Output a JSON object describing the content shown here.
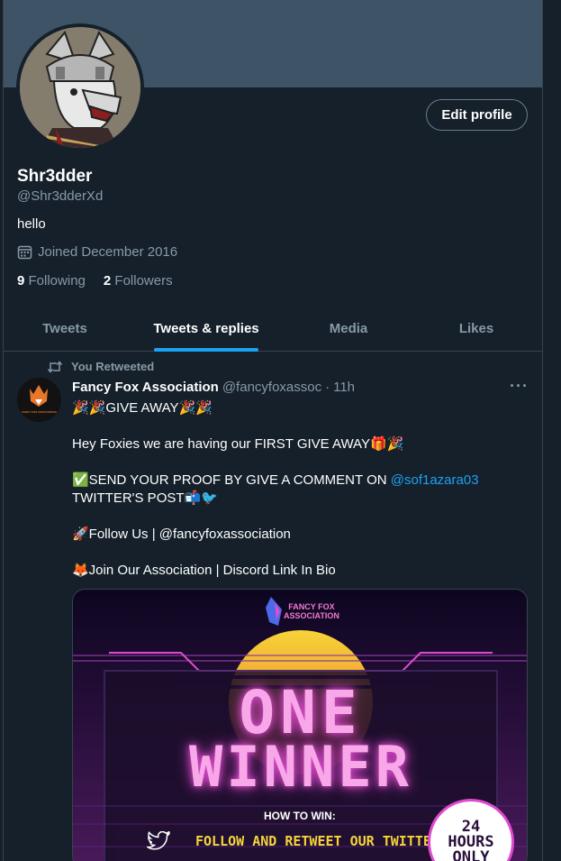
{
  "profile": {
    "display_name": "Shr3dder",
    "handle": "@Shr3dderXd",
    "bio": "hello",
    "joined": "Joined December 2016",
    "following_count": "9",
    "following_label": "Following",
    "followers_count": "2",
    "followers_label": "Followers",
    "edit_button": "Edit profile"
  },
  "tabs": [
    {
      "label": "Tweets",
      "active": false
    },
    {
      "label": "Tweets & replies",
      "active": true
    },
    {
      "label": "Media",
      "active": false
    },
    {
      "label": "Likes",
      "active": false
    }
  ],
  "tweet": {
    "retweet_label": "You Retweeted",
    "author": "Fancy Fox Association",
    "author_handle": "@fancyfoxassoc",
    "separator": "·",
    "time": "11h",
    "more": "···",
    "line1": "🎉🎉GIVE AWAY🎉🎉",
    "line2": "Hey Foxies we are having our FIRST GIVE AWAY🎁🎉",
    "line3_pre": "✅SEND YOUR PROOF BY GIVE A COMMENT ON ",
    "line3_mention": "@sof1azara03",
    "line3_post": " TWITTER'S POST📬🐦",
    "line4": "🚀Follow Us | @fancyfoxassociation",
    "line5": "🦊Join Our Association | Discord Link In Bio",
    "avatar_text": "FANCY FOX ASSOCIATION",
    "media": {
      "logo_text_1": "FANCY FOX",
      "logo_text_2": "ASSOCIATION",
      "headline_1": "ONE",
      "headline_2": "WINNER",
      "how_to_win": "HOW TO WIN:",
      "follow_text": "FOLLOW AND RETWEET OUR TWITTER",
      "badge_1": "24",
      "badge_2": "HOURS",
      "badge_3": "ONLY"
    }
  },
  "colors": {
    "background": "#15202b",
    "banner": "#3e5366",
    "accent": "#1da1f2",
    "secondary_text": "#8899a6",
    "border": "#38444d"
  },
  "icons": {
    "calendar": "calendar-icon",
    "retweet": "retweet-icon",
    "more": "more-icon",
    "twitter_bird": "twitter-bird-icon"
  }
}
